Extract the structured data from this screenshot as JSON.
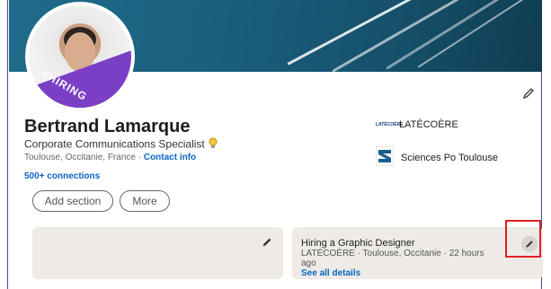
{
  "profile": {
    "name": "Bertrand Lamarque",
    "headline": "Corporate Communications Specialist",
    "location": "Toulouse, Occitanie, France",
    "separator": " · ",
    "contact_label": "Contact info",
    "connections": "500+ connections",
    "hiring_frame_label": "#HIRING"
  },
  "actions": {
    "add_section_label": "Add section",
    "more_label": "More"
  },
  "organizations": [
    {
      "logo_text": "LATÉCOÈRE",
      "name": "LATÉCOÈRE"
    },
    {
      "logo_text": "",
      "name": "Sciences Po Toulouse"
    }
  ],
  "job_card": {
    "title": "Hiring a Graphic Designer",
    "details": "LATÉCOÈRE · Toulouse, Occitanie · 22 hours ago",
    "link": "See all details"
  },
  "colors": {
    "brand_blue": "#0a66c2",
    "hiring_purple": "#7b3fc6",
    "highlight_red": "#e02020",
    "card_bg": "#eeebe6"
  },
  "icons": {
    "edit": "pencil-icon",
    "verified": "lightbulb-icon"
  }
}
